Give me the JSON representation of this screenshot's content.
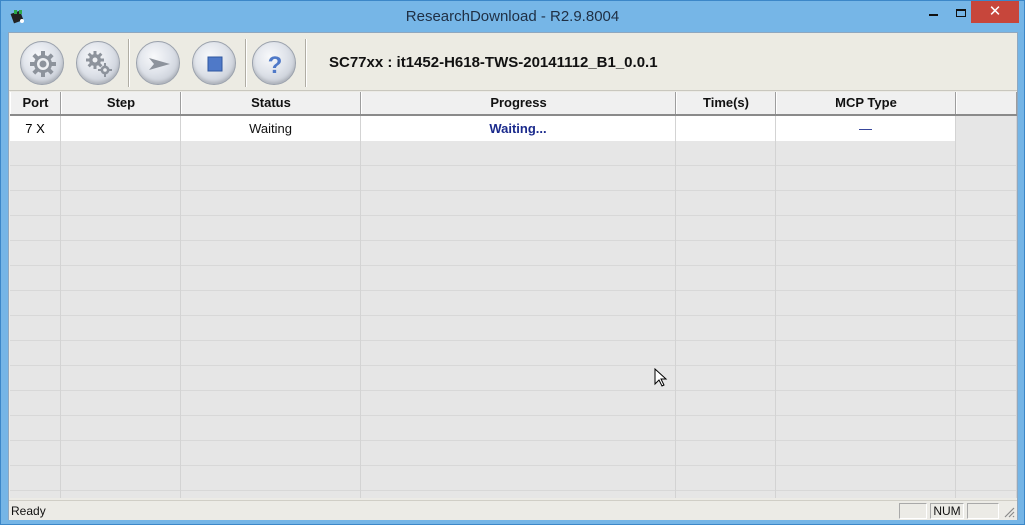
{
  "window": {
    "title": "ResearchDownload - R2.9.8004",
    "controls": {
      "minimize": "minimize",
      "maximize": "maximize",
      "close": "✕"
    }
  },
  "toolbar": {
    "buttons": [
      {
        "name": "load-packet-button",
        "icon": "gear-icon"
      },
      {
        "name": "settings-button",
        "icon": "gears-icon"
      },
      {
        "name": "start-download-button",
        "icon": "play-arrow-icon"
      },
      {
        "name": "stop-download-button",
        "icon": "stop-icon"
      },
      {
        "name": "about-button",
        "icon": "help-icon"
      }
    ],
    "info": "SC77xx : it1452-H618-TWS-20141112_B1_0.0.1"
  },
  "grid": {
    "columns": [
      "Port",
      "Step",
      "Status",
      "Progress",
      "Time(s)",
      "MCP Type"
    ],
    "rows": [
      {
        "port": "7 X",
        "step": "",
        "status": "Waiting",
        "progress": "Waiting...",
        "time": "",
        "mcp": "—"
      }
    ]
  },
  "statusbar": {
    "text": "Ready",
    "num": "NUM"
  },
  "colors": {
    "titlebar": "#76b6e7",
    "close": "#c7463b",
    "progress_text": "#1a2a8c"
  }
}
